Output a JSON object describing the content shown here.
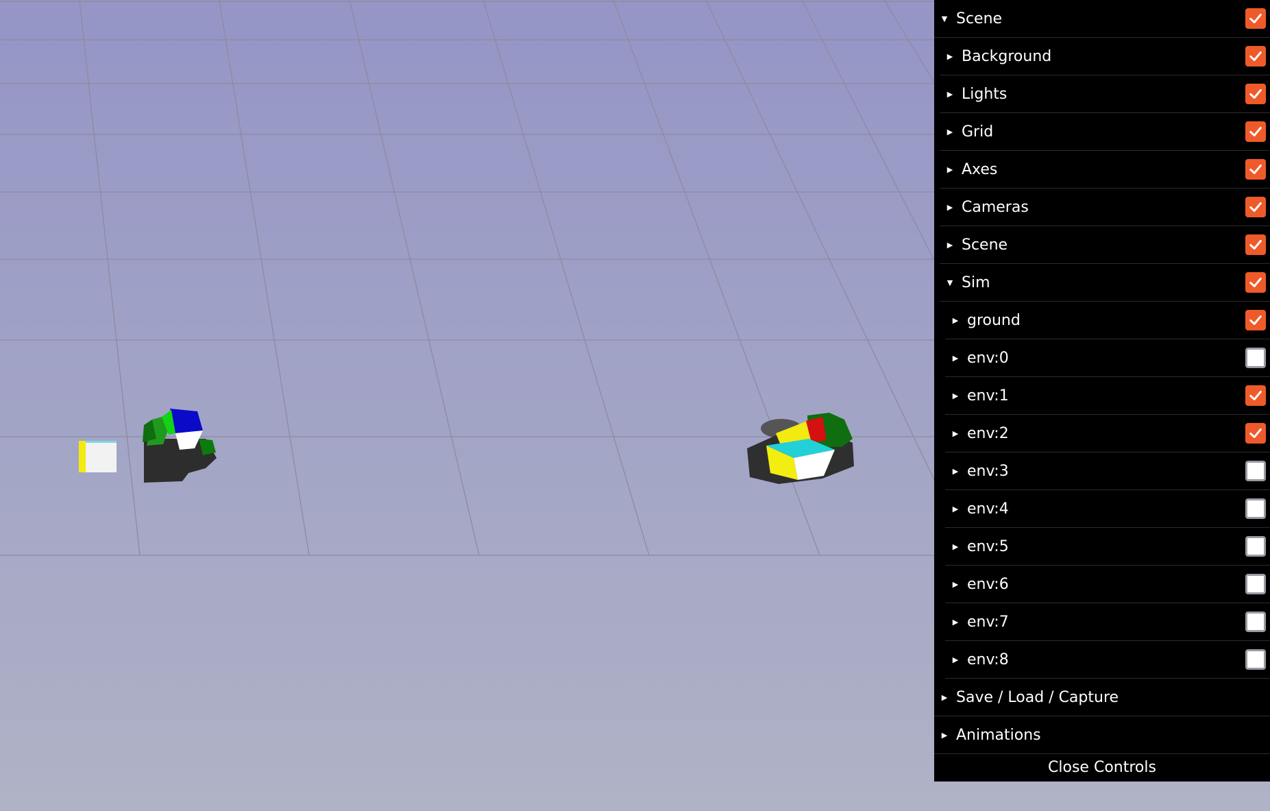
{
  "gui": {
    "scene": {
      "label": "Scene",
      "checked": true,
      "expanded": true
    },
    "scene_children": [
      {
        "label": "Background",
        "checked": true
      },
      {
        "label": "Lights",
        "checked": true
      },
      {
        "label": "Grid",
        "checked": true
      },
      {
        "label": "Axes",
        "checked": true
      },
      {
        "label": "Cameras",
        "checked": true
      },
      {
        "label": "Scene",
        "checked": true
      }
    ],
    "sim": {
      "label": "Sim",
      "checked": true,
      "expanded": true
    },
    "sim_children": [
      {
        "label": "ground",
        "checked": true
      },
      {
        "label": "env:0",
        "checked": false
      },
      {
        "label": "env:1",
        "checked": true
      },
      {
        "label": "env:2",
        "checked": true
      },
      {
        "label": "env:3",
        "checked": false
      },
      {
        "label": "env:4",
        "checked": false
      },
      {
        "label": "env:5",
        "checked": false
      },
      {
        "label": "env:6",
        "checked": false
      },
      {
        "label": "env:7",
        "checked": false
      },
      {
        "label": "env:8",
        "checked": false
      }
    ],
    "save_load_capture": "Save / Load / Capture",
    "animations": "Animations",
    "close_controls": "Close Controls"
  },
  "colors": {
    "checkbox_on": "#ef5a2a",
    "panel_bg": "#000000",
    "sky_top": "#9595c6",
    "sky_bottom": "#b0b2c6"
  }
}
